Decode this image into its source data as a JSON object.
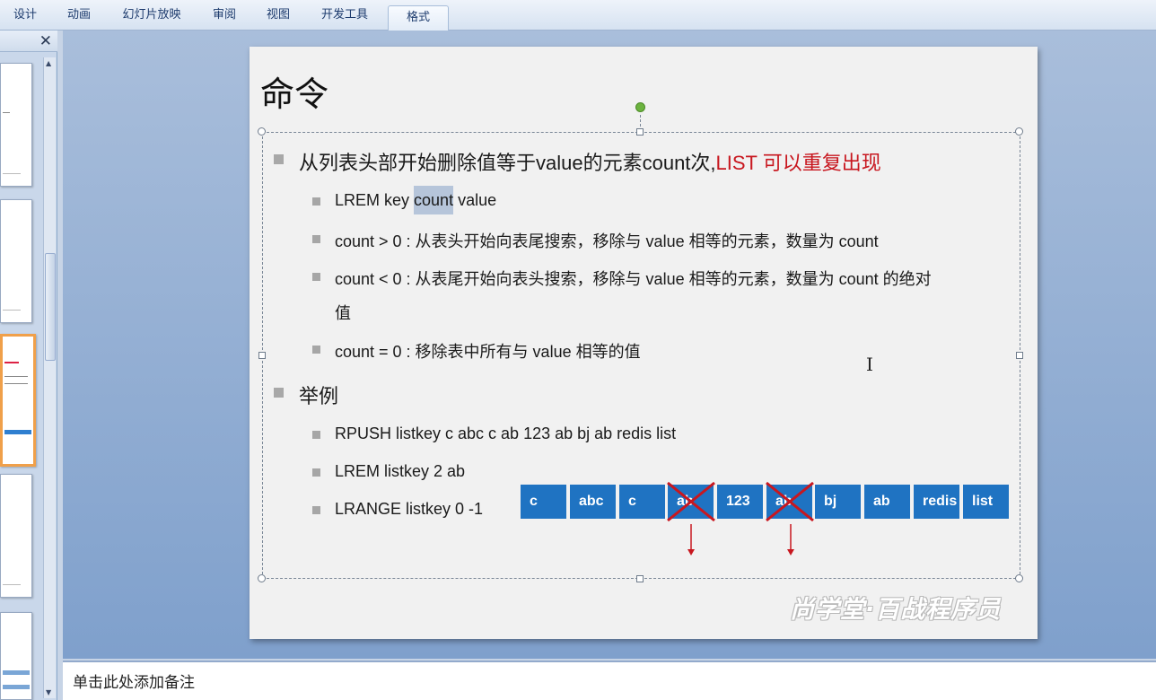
{
  "ribbon": {
    "tabs": [
      "设计",
      "动画",
      "幻灯片放映",
      "审阅",
      "视图",
      "开发工具",
      "格式"
    ]
  },
  "thumbnails_pane": {
    "close_glyph": "✕"
  },
  "slide": {
    "title": "命令",
    "bullets": {
      "main1_black": "从列表头部开始删除值等于value的元素count次,",
      "main1_red": "LIST  可以重复出现",
      "sub1_a": "LREM key ",
      "sub1_hl": "count",
      "sub1_b": " value",
      "sub2": "count > 0 : 从表头开始向表尾搜索，移除与  value 相等的元素，数量为 count",
      "sub3_line1": "count < 0 : 从表尾开始向表头搜索，移除与  value 相等的元素，数量为 count 的绝对",
      "sub3_line2": "值",
      "sub4": "count = 0 : 移除表中所有与 value 相等的值",
      "main2": "举例",
      "ex1": "RPUSH listkey c abc c ab 123 ab bj ab redis list",
      "ex2": "LREM listkey 2 ab",
      "ex3": "LRANGE listkey 0  -1"
    },
    "list_boxes": [
      "c",
      "abc",
      "c",
      "ab",
      "123",
      "ab",
      "bj",
      "ab",
      "redis",
      "list"
    ],
    "watermark": "尚学堂·百战程序员"
  },
  "colors": {
    "box_blue": "#1f73c2",
    "cross_red": "#c8171f",
    "accent_red_text": "#c8171f"
  },
  "notes": {
    "placeholder": "单击此处添加备注"
  }
}
